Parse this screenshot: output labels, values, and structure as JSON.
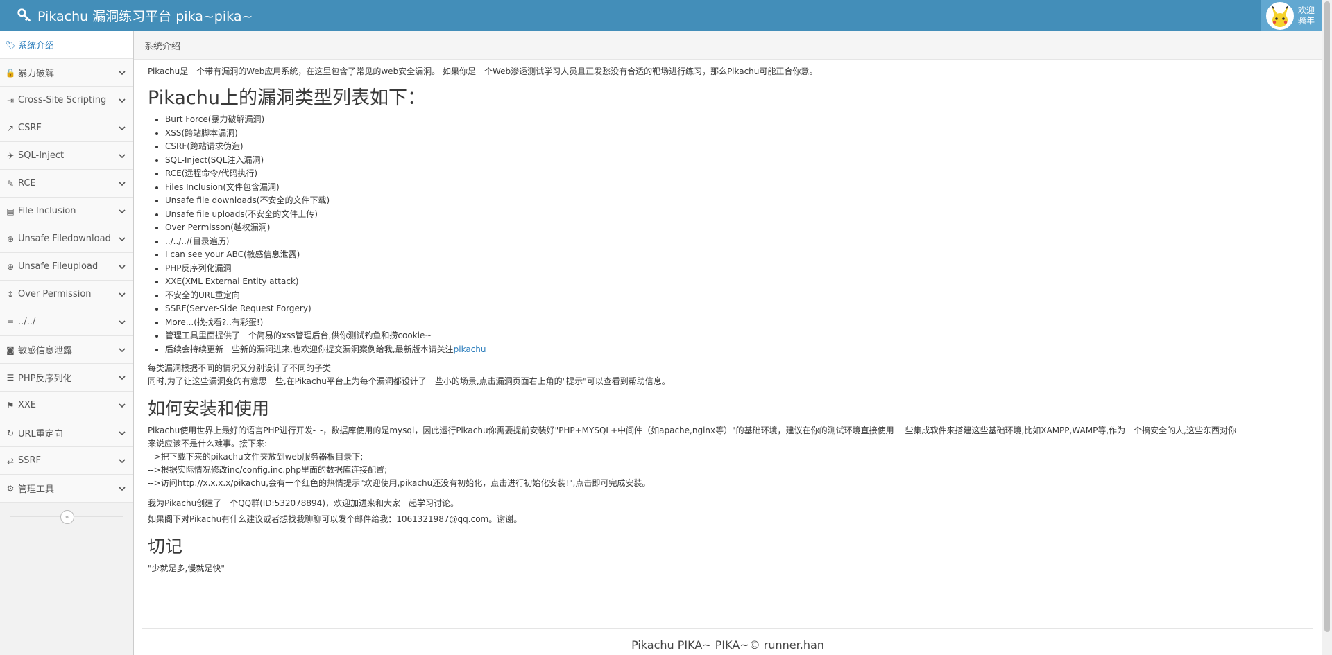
{
  "header": {
    "brand": "Pikachu 漏洞练习平台 pika~pika~",
    "welcome_line1": "欢迎",
    "welcome_line2": "骚年"
  },
  "sidebar": {
    "items": [
      {
        "label": "系统介绍",
        "icon": "tag-icon",
        "active": true
      },
      {
        "label": "暴力破解",
        "icon": "lock-icon"
      },
      {
        "label": "Cross-Site Scripting",
        "icon": "list-indent-icon"
      },
      {
        "label": "CSRF",
        "icon": "share-icon"
      },
      {
        "label": "SQL-Inject",
        "icon": "plane-icon"
      },
      {
        "label": "RCE",
        "icon": "pencil-icon"
      },
      {
        "label": "File Inclusion",
        "icon": "file-icon"
      },
      {
        "label": "Unsafe Filedownload",
        "icon": "circle-arrow-down-icon"
      },
      {
        "label": "Unsafe Fileupload",
        "icon": "circle-arrow-up-icon"
      },
      {
        "label": "Over Permission",
        "icon": "text-height-icon"
      },
      {
        "label": "../../",
        "icon": "align-left-icon"
      },
      {
        "label": "敏感信息泄露",
        "icon": "camera-icon"
      },
      {
        "label": "PHP反序列化",
        "icon": "align-justify-icon"
      },
      {
        "label": "XXE",
        "icon": "flag-icon"
      },
      {
        "label": "URL重定向",
        "icon": "refresh-icon"
      },
      {
        "label": "SSRF",
        "icon": "exchange-icon"
      },
      {
        "label": "管理工具",
        "icon": "cog-icon"
      }
    ],
    "collapse_glyph": "«"
  },
  "breadcrumb": {
    "current": "系统介绍"
  },
  "main": {
    "intro": "Pikachu是一个带有漏洞的Web应用系统，在这里包含了常见的web安全漏洞。 如果你是一个Web渗透测试学习人员且正发愁没有合适的靶场进行练习，那么Pikachu可能正合你意。",
    "list_heading": "Pikachu上的漏洞类型列表如下：",
    "vuln_list": [
      "Burt Force(暴力破解漏洞)",
      "XSS(跨站脚本漏洞)",
      "CSRF(跨站请求伪造)",
      "SQL-Inject(SQL注入漏洞)",
      "RCE(远程命令/代码执行)",
      "Files Inclusion(文件包含漏洞)",
      "Unsafe file downloads(不安全的文件下载)",
      "Unsafe file uploads(不安全的文件上传)",
      "Over Permisson(越权漏洞)",
      "../../../(目录遍历)",
      "I can see your ABC(敏感信息泄露)",
      "PHP反序列化漏洞",
      "XXE(XML External Entity attack)",
      "不安全的URL重定向",
      "SSRF(Server-Side Request Forgery)",
      "More...(找找看?..有彩蛋!)",
      "管理工具里面提供了一个简易的xss管理后台,供你测试钓鱼和捞cookie~"
    ],
    "last_item_text": "后续会持续更新一些新的漏洞进来,也欢迎你提交漏洞案例给我,最新版本请关注",
    "last_item_link": "pikachu",
    "note_line1": "每类漏洞根据不同的情况又分别设计了不同的子类",
    "note_line2": "同时,为了让这些漏洞变的有意思一些,在Pikachu平台上为每个漏洞都设计了一些小的场景,点击漏洞页面右上角的\"提示\"可以查看到帮助信息。",
    "install_heading": "如何安装和使用",
    "install_line1": "Pikachu使用世界上最好的语言PHP进行开发-_-，数据库使用的是mysql，因此运行Pikachu你需要提前安装好\"PHP+MYSQL+中间件（如apache,nginx等）\"的基础环境，建议在你的测试环境直接使用 一些集成软件来搭建这些基础环境,比如XAMPP,WAMP等,作为一个搞安全的人,这些东西对你",
    "install_line2": "来说应该不是什么难事。接下来:",
    "install_step1": "-->把下载下来的pikachu文件夹放到web服务器根目录下;",
    "install_step2": "-->根据实际情况修改inc/config.inc.php里面的数据库连接配置;",
    "install_step3": "-->访问http://x.x.x.x/pikachu,会有一个红色的热情提示\"欢迎使用,pikachu还没有初始化，点击进行初始化安装!\",点击即可完成安装。",
    "qq_line": "我为Pikachu创建了一个QQ群(ID:532078894)，欢迎加进来和大家一起学习讨论。",
    "mail_line": "如果阁下对Pikachu有什么建议或者想找我聊聊可以发个邮件给我：1061321987@qq.com。谢谢。",
    "remember_heading": "切记",
    "remember_text": "\"少就是多,慢就是快\""
  },
  "footer": {
    "text": "Pikachu PIKA~ PIKA~© runner.han"
  }
}
